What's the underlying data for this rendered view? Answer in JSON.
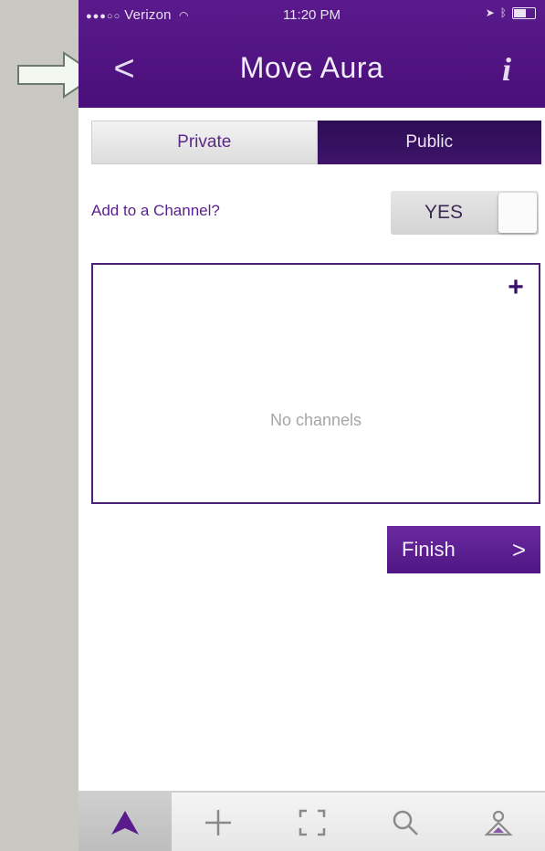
{
  "status_bar": {
    "carrier": "Verizon",
    "time": "11:20 PM"
  },
  "nav": {
    "title": "Move Aura",
    "back_symbol": "<",
    "info_symbol": "i"
  },
  "visibility": {
    "options": [
      "Private",
      "Public"
    ],
    "selected": "Public"
  },
  "channel_toggle": {
    "label": "Add to a Channel?",
    "value": "YES"
  },
  "channels": {
    "empty_message": "No channels",
    "add_symbol": "+"
  },
  "finish": {
    "label": "Finish",
    "chevron": ">"
  },
  "tabs": [
    {
      "icon": "aura-home-icon",
      "active": true
    },
    {
      "icon": "plus-icon",
      "active": false
    },
    {
      "icon": "scan-frame-icon",
      "active": false
    },
    {
      "icon": "search-icon",
      "active": false
    },
    {
      "icon": "profile-icon",
      "active": false
    }
  ],
  "colors": {
    "brand_purple": "#4a0f7a",
    "segment_selected": "#2d0d55",
    "label_purple": "#5a1f8e",
    "finish_button": "#5e1f92",
    "callout_arrow": "#f2f7ef"
  }
}
